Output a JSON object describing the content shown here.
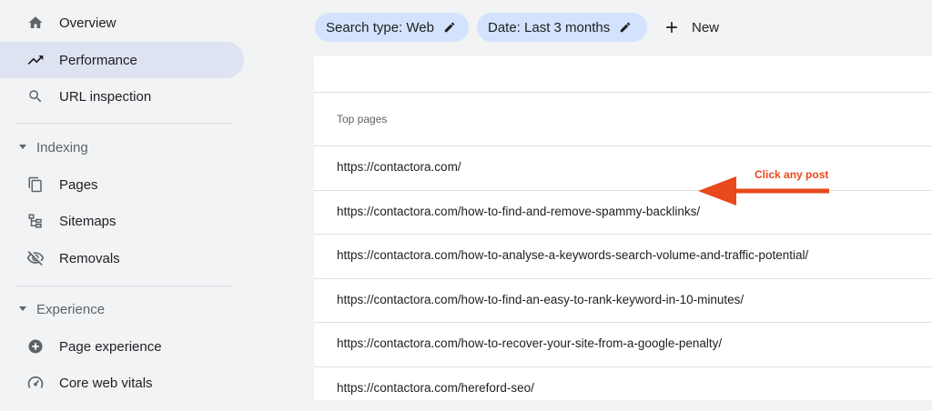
{
  "sidebar": {
    "items": [
      {
        "label": "Overview",
        "icon": "home-icon"
      },
      {
        "label": "Performance",
        "icon": "trending-up-icon",
        "active": true
      },
      {
        "label": "URL inspection",
        "icon": "search-icon"
      }
    ],
    "sections": [
      {
        "label": "Indexing",
        "items": [
          {
            "label": "Pages",
            "icon": "pages-icon"
          },
          {
            "label": "Sitemaps",
            "icon": "sitemap-icon"
          },
          {
            "label": "Removals",
            "icon": "removals-icon"
          }
        ]
      },
      {
        "label": "Experience",
        "items": [
          {
            "label": "Page experience",
            "icon": "page-experience-icon"
          },
          {
            "label": "Core web vitals",
            "icon": "speedometer-icon"
          }
        ]
      }
    ]
  },
  "filters": {
    "search_type": "Search type: Web",
    "date": "Date: Last 3 months",
    "new_label": "New"
  },
  "table": {
    "header": "Top pages",
    "rows": [
      "https://contactora.com/",
      "https://contactora.com/how-to-find-and-remove-spammy-backlinks/",
      "https://contactora.com/how-to-analyse-a-keywords-search-volume-and-traffic-potential/",
      "https://contactora.com/how-to-find-an-easy-to-rank-keyword-in-10-minutes/",
      "https://contactora.com/how-to-recover-your-site-from-a-google-penalty/",
      "https://contactora.com/hereford-seo/"
    ]
  },
  "annotation": {
    "text": "Click any post",
    "color": "#e8491d"
  },
  "colors": {
    "active_bg": "#dde3f0",
    "chip_bg": "#d3e3fd"
  }
}
